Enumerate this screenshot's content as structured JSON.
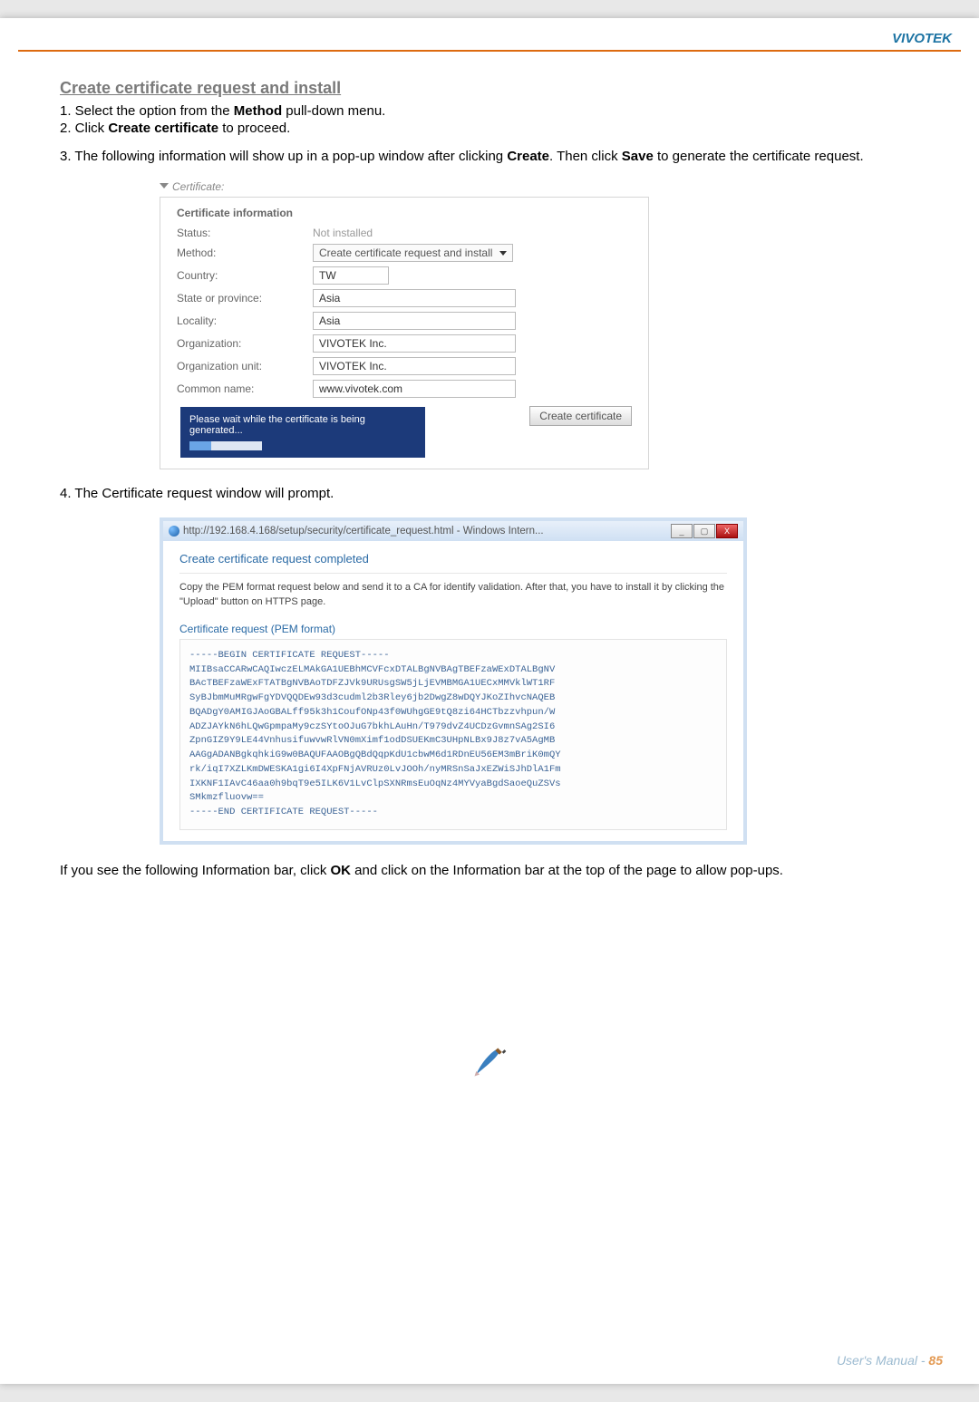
{
  "brand": "VIVOTEK",
  "heading": "Create certificate request and install",
  "steps": {
    "s1_a": "1. Select the option from the ",
    "s1_b": "Method",
    "s1_c": " pull-down menu.",
    "s2_a": "2. Click ",
    "s2_b": "Create certificate",
    "s2_c": " to proceed.",
    "s3_a": "3. The following information will show up in a pop-up window after clicking ",
    "s3_b": "Create",
    "s3_c": ". Then click ",
    "s3_d": "Save",
    "s3_e": " to generate the certificate request.",
    "s4": "4. The Certificate request window will prompt.",
    "note_a": "If you see the following Information bar, click ",
    "note_b": "OK",
    "note_c": " and click on the Information bar at the top of the page to allow pop-ups."
  },
  "cert": {
    "title_label": "Certificate:",
    "section_label": "Certificate information",
    "rows": {
      "status_label": "Status:",
      "status_value": "Not installed",
      "method_label": "Method:",
      "method_value": "Create certificate request and install",
      "country_label": "Country:",
      "country_value": "TW",
      "state_label": "State or province:",
      "state_value": "Asia",
      "locality_label": "Locality:",
      "locality_value": "Asia",
      "org_label": "Organization:",
      "org_value": "VIVOTEK Inc.",
      "orgunit_label": "Organization unit:",
      "orgunit_value": "VIVOTEK Inc.",
      "cn_label": "Common name:",
      "cn_value": "www.vivotek.com"
    },
    "create_btn": "Create certificate",
    "wait_msg": "Please wait while the certificate is being generated..."
  },
  "req": {
    "url": "http://192.168.4.168/setup/security/certificate_request.html - Windows Intern...",
    "win_min": "_",
    "win_max": "▢",
    "win_close": "X",
    "completed": "Create certificate request completed",
    "desc": "Copy the PEM format request below and send it to a CA for identify validation. After that, you have to install it by clicking the \"Upload\" button on HTTPS page.",
    "subhead": "Certificate request (PEM format)",
    "pem": "-----BEGIN CERTIFICATE REQUEST-----\nMIIBsaCCARwCAQIwczELMAkGA1UEBhMCVFcxDTALBgNVBAgTBEFzaWExDTALBgNV\nBAcTBEFzaWExFTATBgNVBAoTDFZJVk9URUsgSW5jLjEVMBMGA1UECxMMVklWT1RF\nSyBJbmMuMRgwFgYDVQQDEw93d3cudml2b3Rley6jb2DwgZ8wDQYJKoZIhvcNAQEB\nBQADgY0AMIGJAoGBALff95k3h1CoufONp43f0WUhgGE9tQ8zi64HCTbzzvhpun/W\nADZJAYkN6hLQwGpmpaMy9czSYtoOJuG7bkhLAuHn/T979dvZ4UCDzGvmnSAg2SI6\nZpnGIZ9Y9LE44VnhusifuwvwRlVN0mXimf1odDSUEKmC3UHpNLBx9J8z7vA5AgMB\nAAGgADANBgkqhkiG9w0BAQUFAAOBgQBdQqpKdU1cbwM6d1RDnEU56EM3mBriK0mQY\nrk/iqI7XZLKmDWESKA1gi6I4XpFNjAVRUz0LvJOOh/nyMRSnSaJxEZWiSJhDlA1Fm\nIXKNF1IAvC46aa0h9bqT9e5ILK6V1LvClpSXNRmsEuOqNz4MYVyaBgdSaoeQuZSVs\nSMkmzfluovw==\n-----END CERTIFICATE REQUEST-----"
  },
  "footer": {
    "text": "User's Manual - ",
    "pg": "85"
  }
}
